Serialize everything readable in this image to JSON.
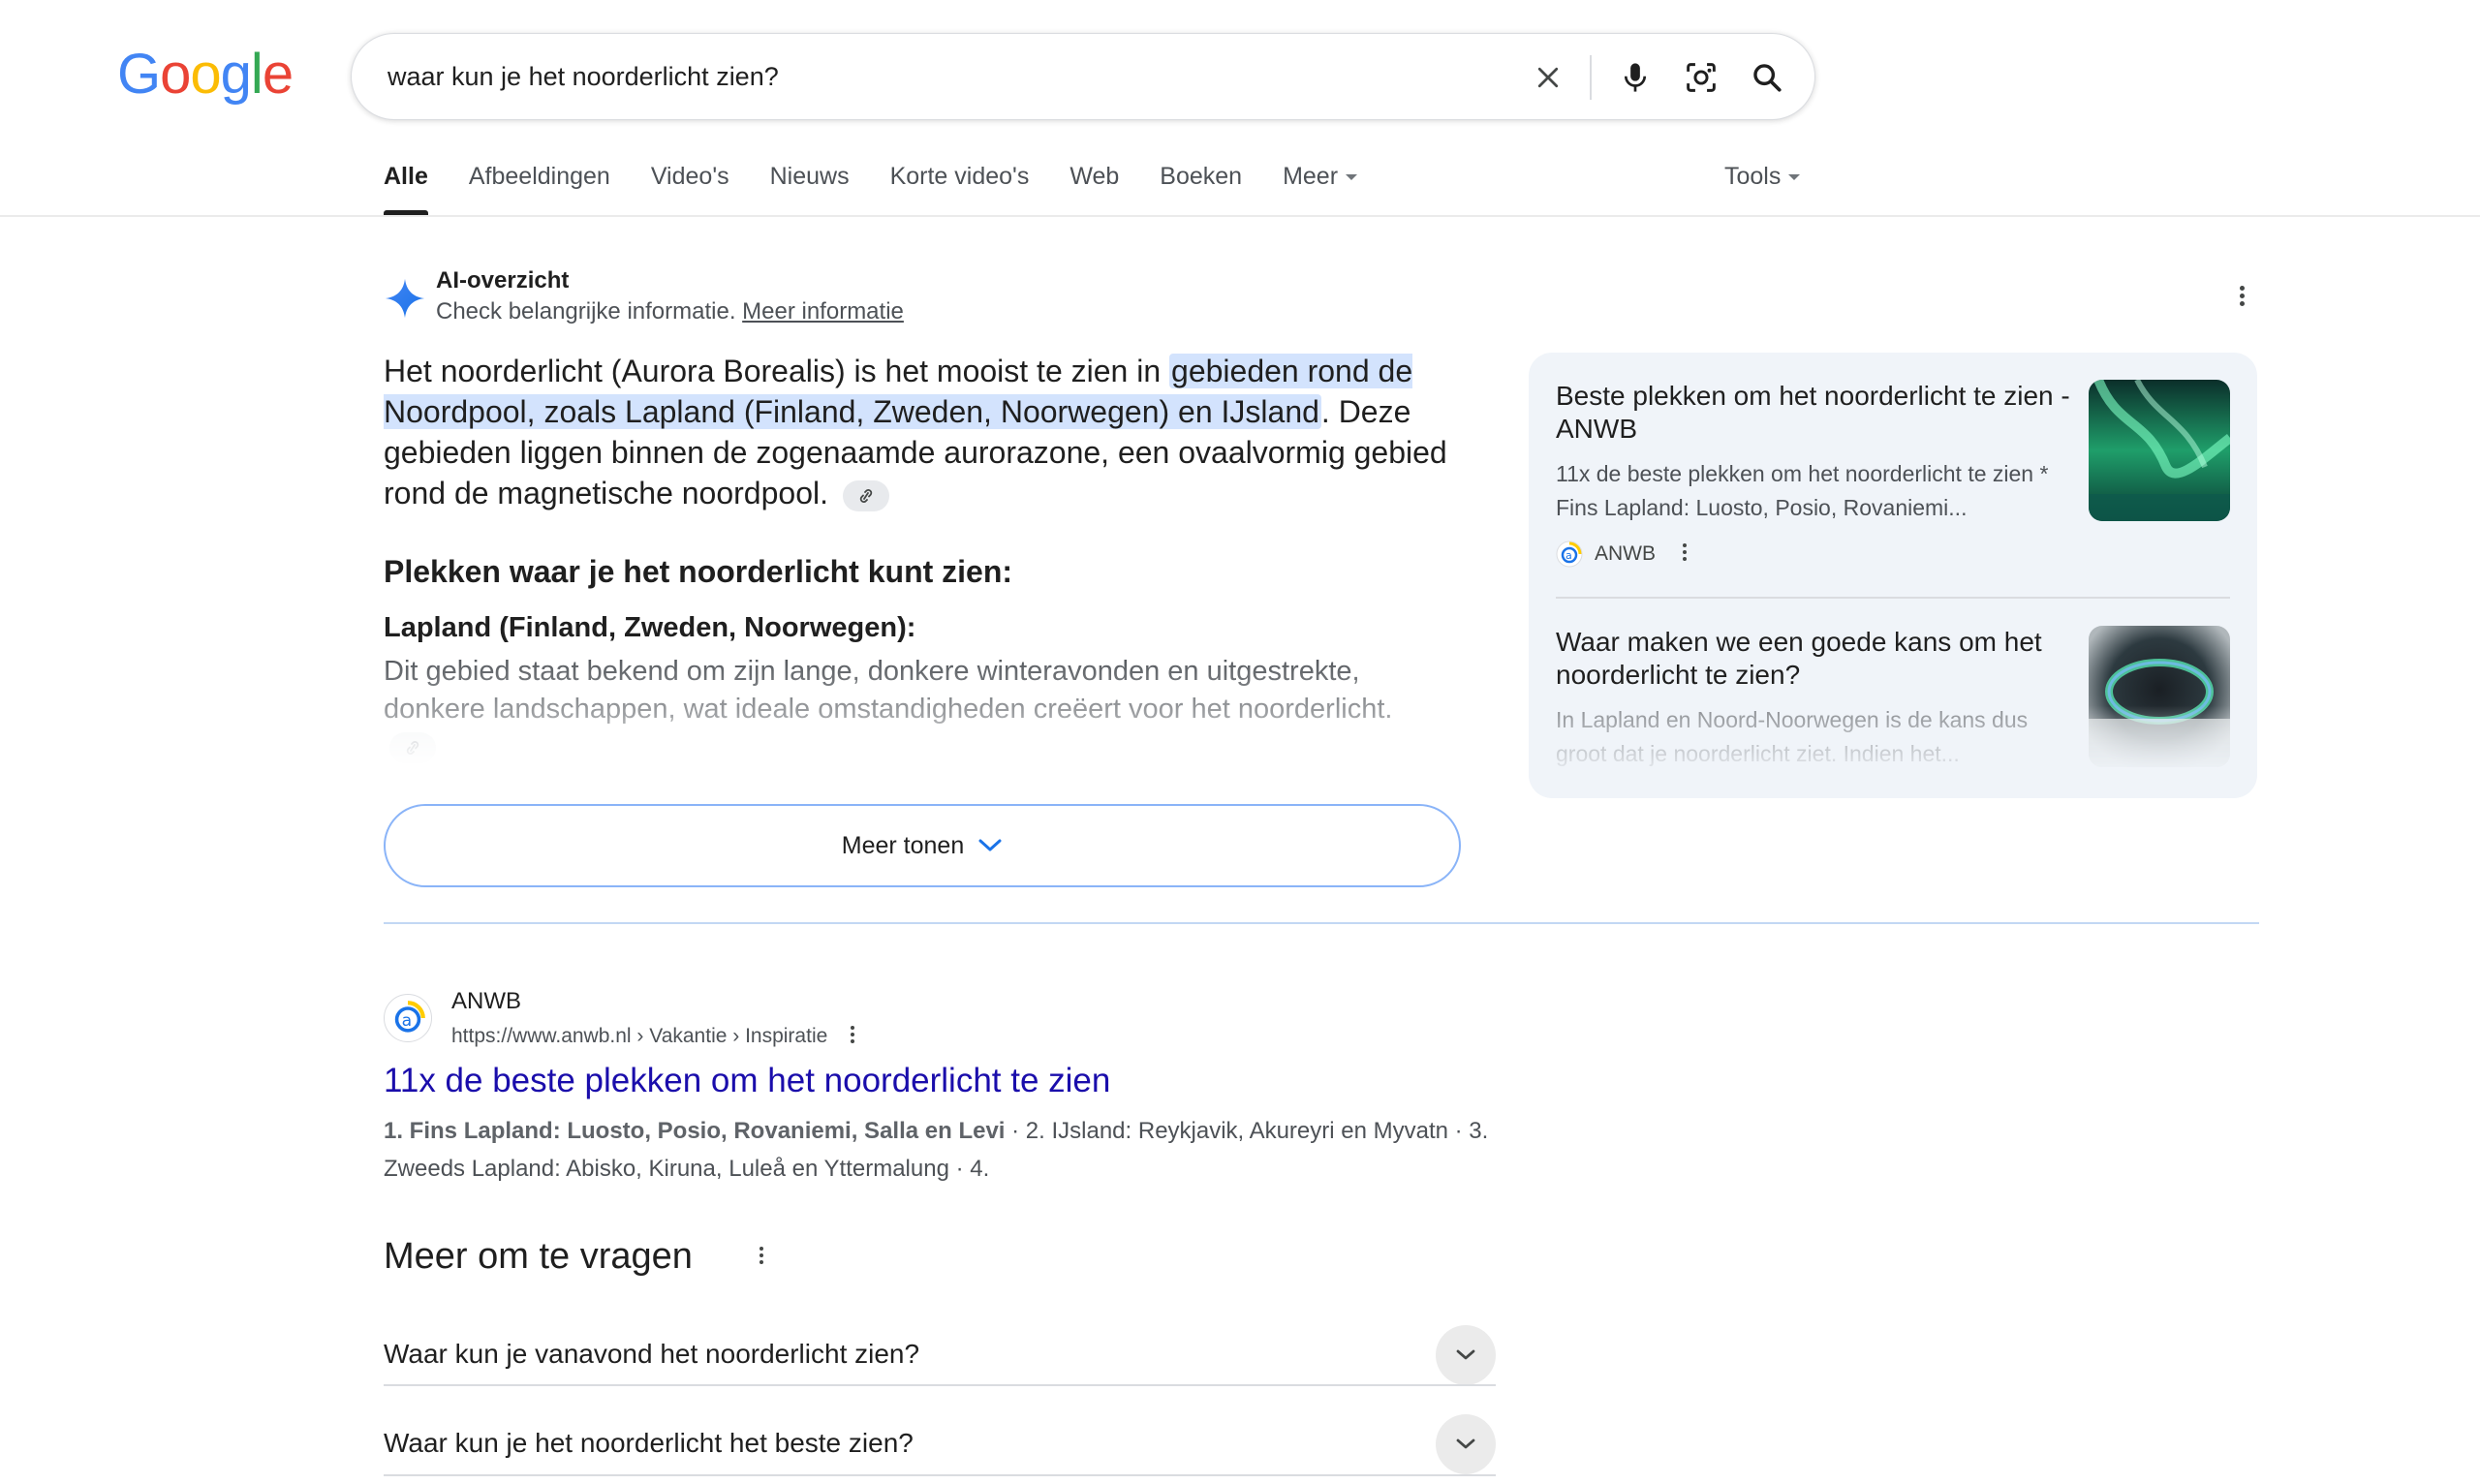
{
  "brand": {
    "logo_letters": [
      "G",
      "o",
      "o",
      "g",
      "l",
      "e"
    ],
    "logo_colors": [
      "#4285f4",
      "#ea4335",
      "#fbbc05",
      "#4285f4",
      "#34a853",
      "#ea4335"
    ]
  },
  "search": {
    "query": "waar kun je het noorderlicht zien?",
    "icons": [
      "close-icon",
      "microphone-icon",
      "camera-lens-icon",
      "search-icon"
    ]
  },
  "tabs": [
    {
      "label": "Alle",
      "active": true
    },
    {
      "label": "Afbeeldingen"
    },
    {
      "label": "Video's"
    },
    {
      "label": "Nieuws"
    },
    {
      "label": "Korte video's"
    },
    {
      "label": "Web"
    },
    {
      "label": "Boeken"
    },
    {
      "label": "Meer"
    }
  ],
  "tools_label": "Tools",
  "ai_overview": {
    "title": "AI-overzicht",
    "subtitle": "Check belangrijke informatie.",
    "more_info": "Meer informatie",
    "intro_before": "Het noorderlicht (Aurora Borealis) is het mooist te zien in ",
    "intro_highlight": "gebieden rond de Noordpool, zoals Lapland (Finland, Zweden, Noorwegen) en IJsland",
    "intro_after": ". Deze gebieden liggen binnen de zogenaamde aurorazone, een ovaalvormig gebied rond de magnetische noordpool.",
    "heading": "Plekken waar je het noorderlicht kunt zien:",
    "subheading": "Lapland (Finland, Zweden, Noorwegen):",
    "fade_text": "Dit gebied staat bekend om zijn lange, donkere winteravonden en uitgestrekte, donkere landschappen, wat ideale omstandigheden creëert voor het noorderlicht.",
    "show_more": "Meer tonen",
    "accent_color": "#4285f4",
    "highlight_color": "#d3e3fd"
  },
  "side_cards": [
    {
      "title": "Beste plekken om het noorderlicht te zien - ANWB",
      "snippet": "11x de beste plekken om het noorderlicht te zien * Fins Lapland: Luosto, Posio, Rovaniemi...",
      "source": "ANWB",
      "thumb": "aurora-image"
    },
    {
      "title": "Waar maken we een goede kans om het noorderlicht te zien?",
      "snippet": "In Lapland en Noord-Noorwegen is de kans dus groot dat je noorderlicht ziet. Indien het...",
      "thumb": "aurora-ring-image"
    }
  ],
  "result": {
    "site_name": "ANWB",
    "url": "https://www.anwb.nl › Vakantie › Inspiratie",
    "title": "11x de beste plekken om het noorderlicht te zien",
    "snippet_bold": "1. Fins Lapland: Luosto, Posio, Rovaniemi, Salla en Levi",
    "snippet_rest": " · 2. IJsland: Reykjavik, Akureyri en Myvatn · 3. Zweeds Lapland: Abisko, Kiruna, Luleå en Yttermalung · 4.",
    "link_color": "#1a0dab"
  },
  "paa": {
    "title": "Meer om te vragen",
    "questions": [
      "Waar kun je vanavond het noorderlicht zien?",
      "Waar kun je het noorderlicht het beste zien?"
    ]
  }
}
